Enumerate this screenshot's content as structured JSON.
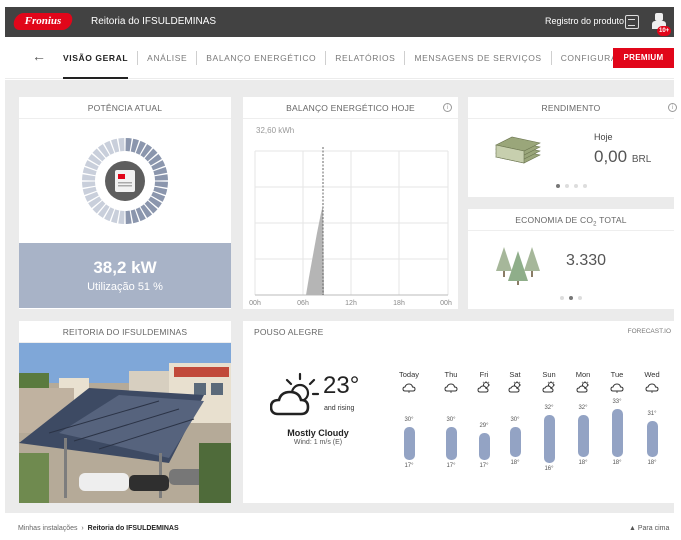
{
  "header": {
    "logo_text": "Fronius",
    "title": "Reitoria do IFSULDEMINAS",
    "register_link": "Registro do produto",
    "notification_badge": "10+"
  },
  "nav": {
    "tabs": [
      {
        "label": "VISÃO GERAL"
      },
      {
        "label": "ANÁLISE"
      },
      {
        "label": "BALANÇO ENERGÉTICO"
      },
      {
        "label": "RELATÓRIOS"
      },
      {
        "label": "MENSAGENS DE SERVIÇOS"
      },
      {
        "label": "CONFIGURAÇÕES"
      }
    ],
    "active_tab": "VISÃO GERAL",
    "premium_button": "PREMIUM"
  },
  "power": {
    "title": "POTÊNCIA ATUAL",
    "value": "38,2 kW",
    "utilization": "Utilização 51 %",
    "utilization_fraction": 0.51
  },
  "energy_balance": {
    "title": "BALANÇO ENERGÉTICO HOJE",
    "total": "32,60 kWh",
    "x_ticks": [
      "00h",
      "06h",
      "12h",
      "18h",
      "00h"
    ]
  },
  "yield": {
    "title": "RENDIMENTO",
    "label": "Hoje",
    "value": "0,00",
    "unit": "BRL"
  },
  "co2": {
    "title_prefix": "ECONOMIA DE CO",
    "title_sub": "2",
    "title_suffix": " TOTAL",
    "value": "3.330"
  },
  "site_photo": {
    "title": "REITORIA DO IFSULDEMINAS"
  },
  "weather": {
    "location": "POUSO ALEGRE",
    "forecast_link": "FORECAST.IO",
    "temperature": "23°",
    "trend": "and rising",
    "condition": "Mostly Cloudy",
    "wind": "Wind: 1 m/s (E)",
    "days": [
      {
        "name": "Today",
        "icon": "cloud-icon",
        "high": "30°",
        "low": "17°"
      },
      {
        "name": "Thu",
        "icon": "cloud-icon",
        "high": "30°",
        "low": "17°"
      },
      {
        "name": "Fri",
        "icon": "partly-cloudy-icon",
        "high": "29°",
        "low": "17°"
      },
      {
        "name": "Sat",
        "icon": "partly-cloudy-icon",
        "high": "30°",
        "low": "18°"
      },
      {
        "name": "Sun",
        "icon": "partly-cloudy-icon",
        "high": "32°",
        "low": "16°"
      },
      {
        "name": "Mon",
        "icon": "partly-cloudy-icon",
        "high": "32°",
        "low": "18°"
      },
      {
        "name": "Tue",
        "icon": "cloud-icon",
        "high": "33°",
        "low": "18°"
      },
      {
        "name": "Wed",
        "icon": "cloud-icon",
        "high": "31°",
        "low": "18°"
      }
    ]
  },
  "footer": {
    "breadcrumb_root": "Minhas instalações",
    "breadcrumb_sep": "›",
    "breadcrumb_current": "Reitoria do IFSULDEMINAS",
    "scroll_top": "Para cima"
  },
  "colors": {
    "brand_red": "#e1061a",
    "header_bg": "#424242",
    "power_panel": "#a8b3c7",
    "weather_bar": "#93a3c4"
  }
}
